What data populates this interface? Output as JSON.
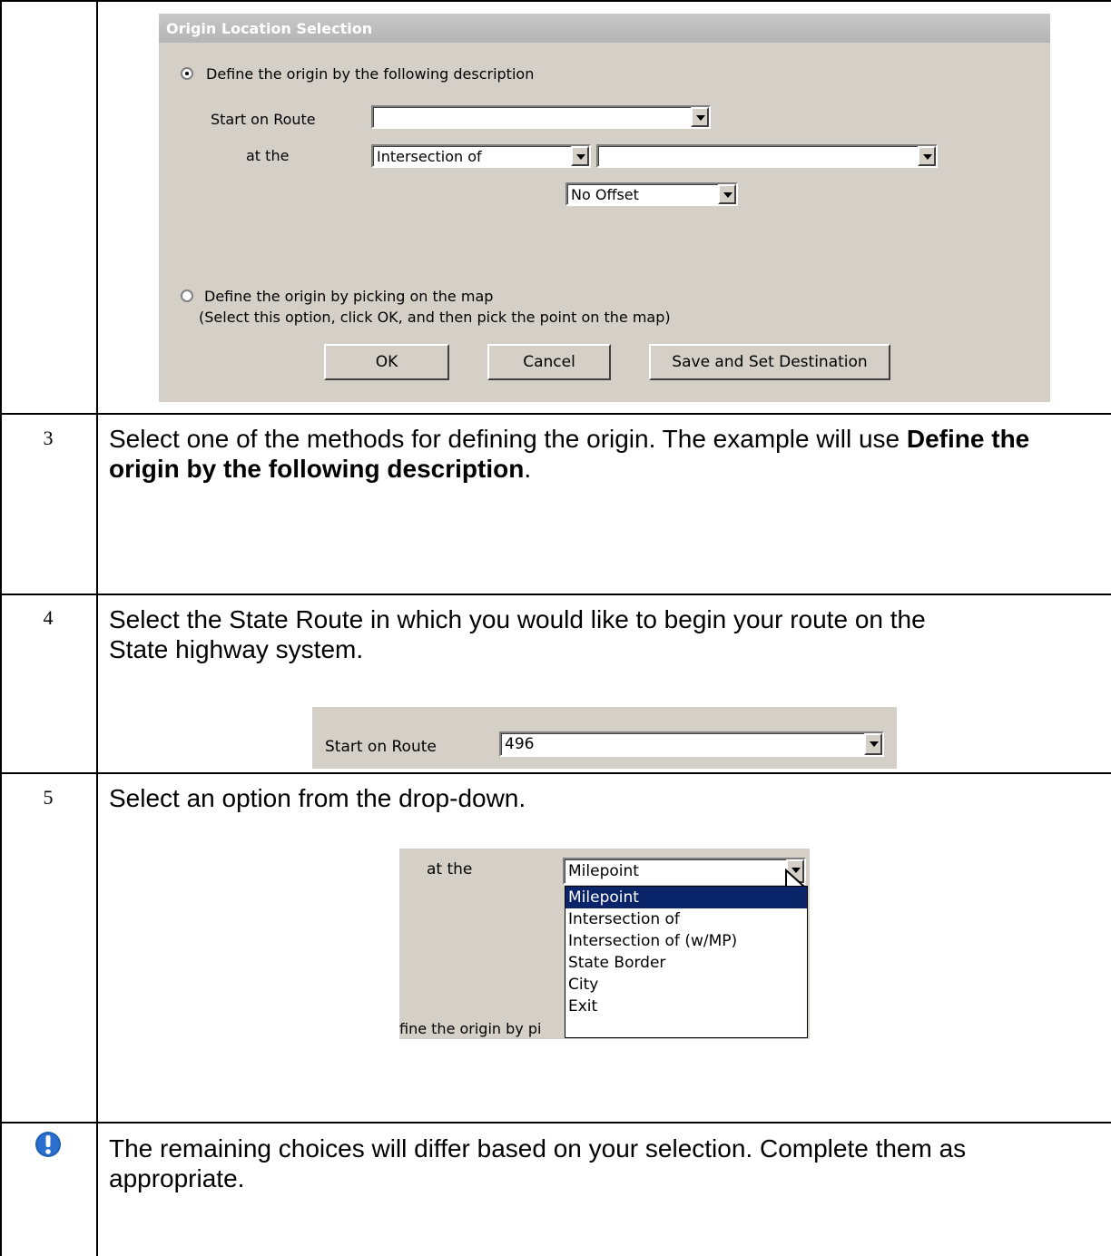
{
  "dialog": {
    "title": "Origin Location Selection",
    "radio_description_label": "Define the origin by the following description",
    "radio_description_selected": true,
    "start_on_route_label": "Start on Route",
    "start_on_route_value": "",
    "at_the_label": "at the",
    "at_the_value": "Intersection of",
    "intersection_value": "",
    "offset_value": "No Offset",
    "radio_map_label": "Define the origin by picking on the map",
    "radio_map_selected": false,
    "radio_map_hint": "(Select this option, click OK, and then pick the point on the map)",
    "ok_label": "OK",
    "cancel_label": "Cancel",
    "save_label": "Save and Set Destination"
  },
  "steps": [
    {
      "number": "3",
      "text_plain": "Select one of the methods for defining the origin.  The example will use ",
      "text_bold": "Define the origin by the following description",
      "text_end": "."
    },
    {
      "number": "4",
      "text": "Select the State Route in which you would like to begin your route on the State highway system.",
      "snippet": {
        "label": "Start on Route",
        "value": "496"
      }
    },
    {
      "number": "5",
      "text": "Select an option from the drop-down.",
      "snippet": {
        "label": "at the",
        "value": "Milepoint",
        "options": [
          "Milepoint",
          "Intersection of",
          "Intersection of (w/MP)",
          "State Border",
          "City",
          "Exit"
        ],
        "selected_index": 0,
        "background_text": "fine the origin by pi"
      }
    }
  ],
  "note": {
    "icon": "exclamation-icon",
    "text": "The remaining choices will differ based on your selection.  Complete them as appropriate."
  },
  "colors": {
    "dialog_bg": "#d4d0c8",
    "title_bar": "#c0c0c0",
    "title_text": "#ffffff",
    "selection": "#0a246a",
    "note_icon": "#1f5fb4"
  }
}
